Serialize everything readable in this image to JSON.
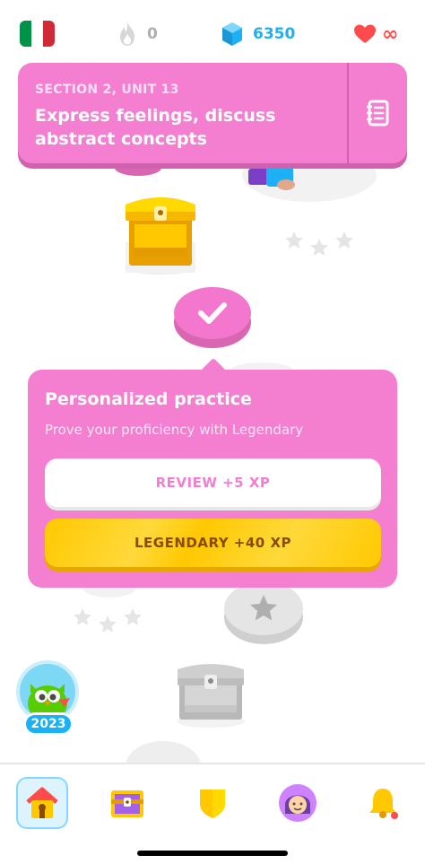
{
  "app": {
    "name": "Duolingo"
  },
  "topbar": {
    "course_flag": {
      "icon": "italy-flag-icon",
      "colors": [
        "#009246",
        "#ffffff",
        "#ce2b37"
      ]
    },
    "streak": {
      "icon": "flame-icon",
      "value": "0"
    },
    "gems": {
      "icon": "gem-icon",
      "value": "6350"
    },
    "hearts": {
      "icon": "heart-icon",
      "value": "∞"
    }
  },
  "section_banner": {
    "section_label": "SECTION 2, UNIT 13",
    "title": "Express feelings, discuss abstract concepts",
    "guidebook_icon": "guidebook-icon"
  },
  "path": {
    "chest_1": {
      "icon": "treasure-chest-icon",
      "state": "unlocked"
    },
    "completed_node": {
      "icon": "checkmark-icon"
    },
    "locked_node": {
      "icon": "star-icon"
    },
    "chest_2": {
      "icon": "treasure-chest-icon",
      "state": "locked"
    },
    "year_badge": {
      "label": "2023",
      "icon": "duo-owl-icon"
    }
  },
  "popover": {
    "title": "Personalized practice",
    "subtitle": "Prove your proficiency with Legendary",
    "review_button": "REVIEW +5 XP",
    "legendary_button": "LEGENDARY +40 XP"
  },
  "bottom_nav": {
    "items": [
      {
        "name": "learn",
        "icon": "home-icon",
        "active": true
      },
      {
        "name": "chest",
        "icon": "treasure-chest-icon",
        "active": false
      },
      {
        "name": "leagues",
        "icon": "shield-icon",
        "active": false
      },
      {
        "name": "profile",
        "icon": "avatar-icon",
        "active": false
      },
      {
        "name": "notifications",
        "icon": "bell-icon",
        "active": false
      }
    ]
  },
  "colors": {
    "accent_pink": "#f47fd1",
    "gem_blue": "#1cb0f6",
    "heart_red": "#ff4b4b",
    "legendary_gold": "#ffc800"
  }
}
